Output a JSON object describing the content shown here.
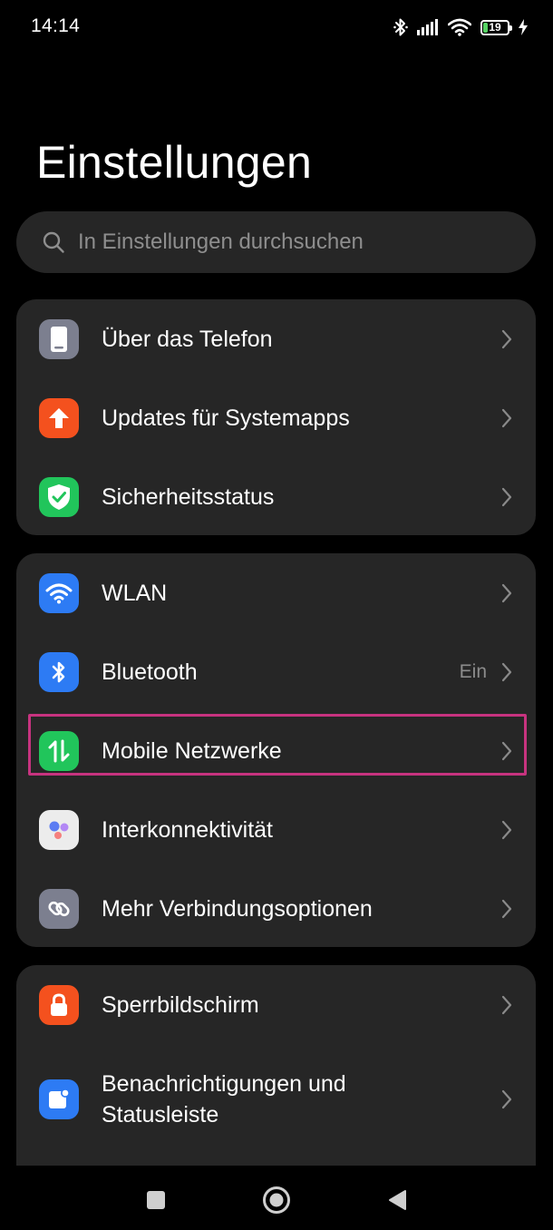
{
  "status": {
    "time": "14:14",
    "battery_level": "19",
    "battery_fraction": 0.19
  },
  "page": {
    "title": "Einstellungen"
  },
  "search": {
    "placeholder": "In Einstellungen durchsuchen"
  },
  "colors": {
    "icon_gray": "#7c7f8f",
    "icon_orange": "#f4511e",
    "icon_green": "#21c55b",
    "icon_blue": "#2d7bf4",
    "highlight": "#c7337f"
  },
  "groups": [
    {
      "items": [
        {
          "label": "Über das Telefon",
          "icon": "phone-icon"
        },
        {
          "label": "Updates für Systemapps",
          "icon": "update-arrow-icon"
        },
        {
          "label": "Sicherheitsstatus",
          "icon": "shield-check-icon"
        }
      ]
    },
    {
      "items": [
        {
          "label": "WLAN",
          "icon": "wifi-icon"
        },
        {
          "label": "Bluetooth",
          "icon": "bluetooth-icon",
          "value": "Ein"
        },
        {
          "label": "Mobile Netzwerke",
          "icon": "mobile-data-icon",
          "highlighted": true
        },
        {
          "label": "Interkonnektivität",
          "icon": "interconnectivity-icon"
        },
        {
          "label": "Mehr Verbindungsoptionen",
          "icon": "link-icon"
        }
      ]
    },
    {
      "items": [
        {
          "label": "Sperrbildschirm",
          "icon": "lock-icon"
        },
        {
          "label": "Benachrichtigungen und Statusleiste",
          "icon": "notification-icon"
        }
      ]
    }
  ],
  "navbar": {
    "buttons": [
      "recents-button",
      "home-button",
      "back-button"
    ]
  }
}
